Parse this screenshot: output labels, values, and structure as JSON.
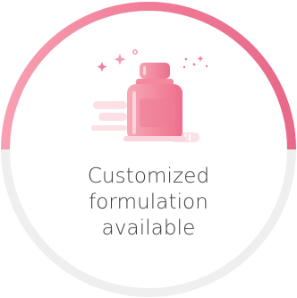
{
  "card": {
    "icon": "medicine-bottle-icon",
    "caption_lines": [
      "Customized",
      "formulation",
      "available"
    ],
    "colors": {
      "gradient_start": "#f38aa0",
      "gradient_end": "#e96d8b",
      "ring_bottom": "#efefef",
      "text": "#3a3a3a"
    }
  }
}
